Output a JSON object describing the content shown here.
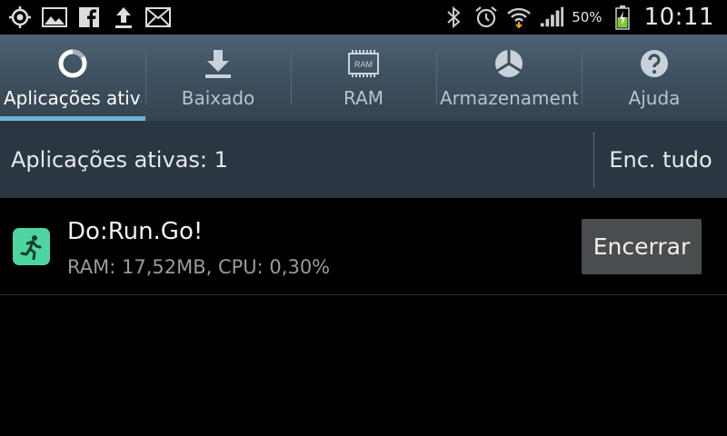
{
  "status_bar": {
    "left_icons": [
      "gps-icon",
      "image-icon",
      "facebook-icon",
      "upload-icon",
      "email-icon"
    ],
    "right_icons": [
      "bluetooth-icon",
      "alarm-icon",
      "wifi-icon",
      "signal-icon",
      "battery-charging-icon"
    ],
    "battery": "50%",
    "time": "10:11"
  },
  "tabs": [
    {
      "label": "Aplicações ativas",
      "icon": "active-apps-ring-icon",
      "active": true
    },
    {
      "label": "Baixado",
      "icon": "download-icon",
      "active": false
    },
    {
      "label": "RAM",
      "icon": "ram-chip-icon",
      "active": false
    },
    {
      "label": "Armazenamento",
      "icon": "storage-pie-icon",
      "active": false
    },
    {
      "label": "Ajuda",
      "icon": "help-icon",
      "active": false
    }
  ],
  "header": {
    "title": "Aplicações ativas: 1",
    "end_all_label": "Enc. tudo"
  },
  "apps": [
    {
      "name": "Do:Run.Go!",
      "stats": "RAM: 17,52MB, CPU: 0,30%",
      "icon": "runner-icon",
      "end_label": "Encerrar"
    }
  ],
  "colors": {
    "tab_active_underline": "#6fb5d9",
    "app_icon_bg": "#4fd6a0",
    "battery_charging": "#7ec83a"
  },
  "ram_chip_text": "RAM"
}
